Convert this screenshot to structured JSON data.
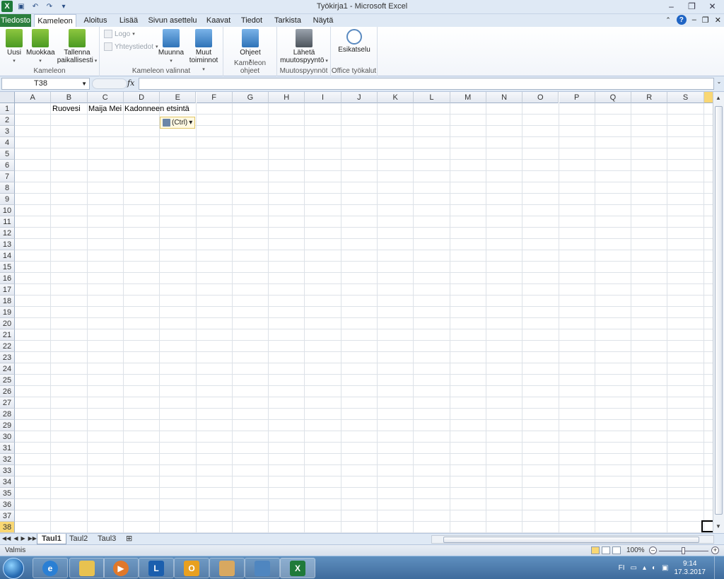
{
  "window": {
    "title": "Työkirja1  -  Microsoft Excel",
    "app_icon": "X",
    "controls": {
      "minimize": "–",
      "restore": "❐",
      "close": "✕"
    }
  },
  "ribbon_tabs": [
    {
      "label": "Tiedosto"
    },
    {
      "label": "Kameleon"
    },
    {
      "label": "Aloitus"
    },
    {
      "label": "Lisää"
    },
    {
      "label": "Sivun asettelu"
    },
    {
      "label": "Kaavat"
    },
    {
      "label": "Tiedot"
    },
    {
      "label": "Tarkista"
    },
    {
      "label": "Näytä"
    }
  ],
  "ribbon": {
    "groups": {
      "kameleon": "Kameleon",
      "valinnat": "Kameleon valinnat",
      "ohjeet": "Kameleon ohjeet",
      "muutospyynnot": "Muutospyynnöt",
      "office": "Office työkalut"
    },
    "buttons": {
      "uusi": "Uusi",
      "muokkaa": "Muokkaa",
      "tallenna_1": "Tallenna",
      "tallenna_2": "paikallisesti",
      "logo": "Logo",
      "yhteystiedot": "Yhteystiedot",
      "muunna": "Muunna",
      "muut_1": "Muut",
      "muut_2": "toiminnot",
      "ohjeet": "Ohjeet",
      "laheta_1": "Lähetä",
      "laheta_2": "muutospyyntö",
      "esikatselu": "Esikatselu"
    }
  },
  "formula_bar": {
    "name_box": "T38",
    "fx_label": "fx",
    "formula": ""
  },
  "columns": [
    "A",
    "B",
    "C",
    "D",
    "E",
    "F",
    "G",
    "H",
    "I",
    "J",
    "K",
    "L",
    "M",
    "N",
    "O",
    "P",
    "Q",
    "R",
    "S",
    ""
  ],
  "rows": [
    "1",
    "2",
    "3",
    "4",
    "5",
    "6",
    "7",
    "8",
    "9",
    "10",
    "11",
    "12",
    "13",
    "14",
    "15",
    "16",
    "17",
    "18",
    "19",
    "20",
    "21",
    "22",
    "23",
    "24",
    "25",
    "26",
    "27",
    "28",
    "29",
    "30",
    "31",
    "32",
    "33",
    "34",
    "35",
    "36",
    "37",
    "38"
  ],
  "cells": {
    "B1": "Ruovesi",
    "C1": "Maija Mei",
    "D1": "Kadonneen etsintä"
  },
  "paste_options": {
    "label": "(Ctrl)",
    "arrow": "▾"
  },
  "sheets": [
    {
      "label": "Taul1",
      "active": true
    },
    {
      "label": "Taul2",
      "active": false
    },
    {
      "label": "Taul3",
      "active": false
    }
  ],
  "status": {
    "text": "Valmis",
    "zoom": "100%",
    "zoom_level_percent": 100
  },
  "taskbar": {
    "lang": "FI",
    "time": "9:14",
    "date": "17.3.2017"
  },
  "colors": {
    "file_tab": "#2c7f3e",
    "selected_header": "#f9d773",
    "taskbar": "#3e6b9c"
  }
}
